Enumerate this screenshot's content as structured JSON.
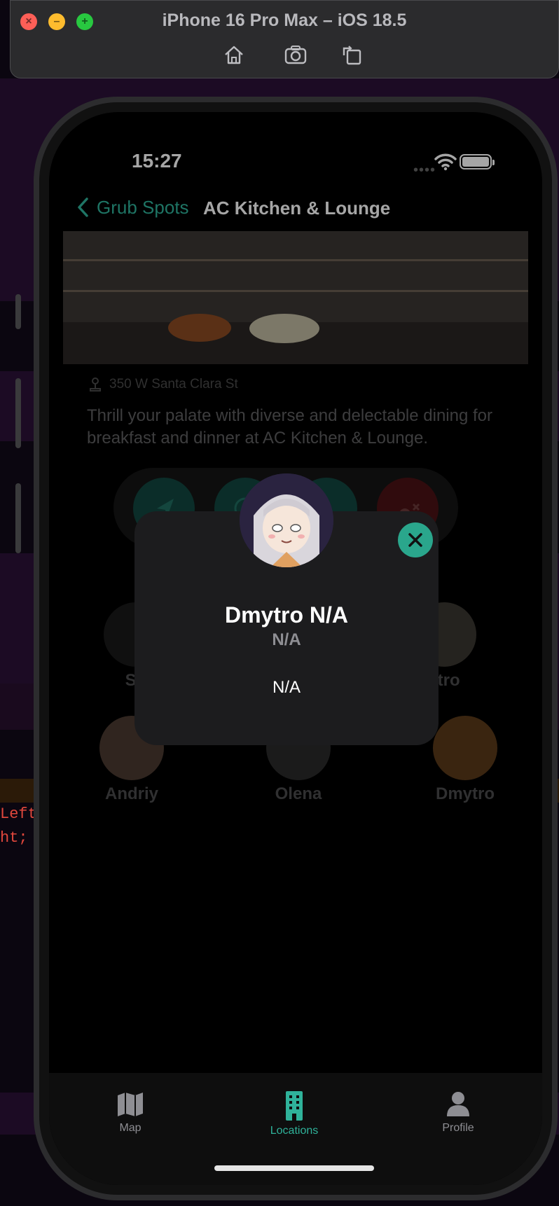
{
  "window": {
    "title": "iPhone 16 Pro Max – iOS 18.5",
    "toolbar_icons": [
      "home-icon",
      "screenshot-icon",
      "rotate-icon"
    ]
  },
  "background_code": [
    "Left",
    "ht;"
  ],
  "status": {
    "time": "15:27"
  },
  "nav": {
    "back_label": "Grub Spots",
    "title": "AC Kitchen & Lounge"
  },
  "detail": {
    "address": "350 W Santa Clara St",
    "description": "Thrill your palate with diverse and delectable dining for breakfast and dinner at AC Kitchen & Lounge."
  },
  "actions": [
    "navigate-icon",
    "website-icon",
    "phone-icon",
    "leave-icon"
  ],
  "people": {
    "row1": [
      "So",
      "ytro"
    ],
    "row2": [
      "Andriy",
      "Olena",
      "Dmytro"
    ]
  },
  "modal": {
    "name": "Dmytro N/A",
    "subtitle": "N/A",
    "bio": "N/A"
  },
  "tabs": [
    {
      "label": "Map",
      "icon": "map-icon"
    },
    {
      "label": "Locations",
      "icon": "building-icon",
      "active": true
    },
    {
      "label": "Profile",
      "icon": "person-icon"
    }
  ],
  "colors": {
    "accent": "#2fb29a",
    "close_button": "#2aa68c",
    "leave_button": "#b3262b"
  }
}
